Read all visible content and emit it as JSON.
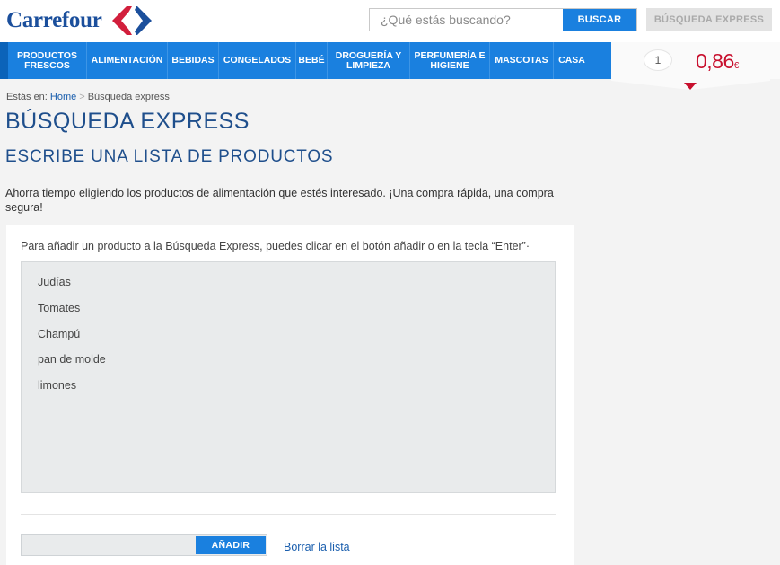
{
  "brand": {
    "name": "Carrefour",
    "logo_icon": "carrefour-logo-icon",
    "colors": {
      "blue": "#1a80df",
      "red": "#c8102e",
      "navy": "#1b4f9c"
    }
  },
  "search": {
    "placeholder": "¿Qué estás buscando?",
    "button": "BUSCAR"
  },
  "header": {
    "express_button": "BÚSQUEDA EXPRESS"
  },
  "nav": {
    "items": [
      {
        "label": "PRODUCTOS FRESCOS"
      },
      {
        "label": "ALIMENTACIÓN"
      },
      {
        "label": "BEBIDAS"
      },
      {
        "label": "CONGELADOS"
      },
      {
        "label": "BEBÉ"
      },
      {
        "label": "DROGUERÍA Y LIMPIEZA"
      },
      {
        "label": "PERFUMERÍA E HIGIENE"
      },
      {
        "label": "MASCOTAS"
      },
      {
        "label": "CASA"
      }
    ]
  },
  "cart": {
    "count": "1",
    "total": "0,86",
    "currency": "€",
    "arrow_icon": "caret-down-icon"
  },
  "breadcrumb": {
    "prefix": "Estás en:",
    "home": "Home",
    "separator": ">",
    "current": "Búsqueda express"
  },
  "page": {
    "title": "BÚSQUEDA EXPRESS",
    "subtitle": "ESCRIBE UNA LISTA DE PRODUCTOS",
    "intro": "Ahorra tiempo eligiendo los productos de alimentación que estés interesado. ¡Una compra rápida, una compra segura!"
  },
  "express": {
    "hint": "Para añadir un producto a la Búsqueda Express, puedes clicar en el botón añadir o en la tecla “Enter”·",
    "products": [
      "Judías",
      "Tomates",
      "Champú",
      "pan de molde",
      "limones"
    ],
    "add_placeholder": "",
    "add_button": "AÑADIR",
    "clear_link": "Borrar la lista"
  }
}
